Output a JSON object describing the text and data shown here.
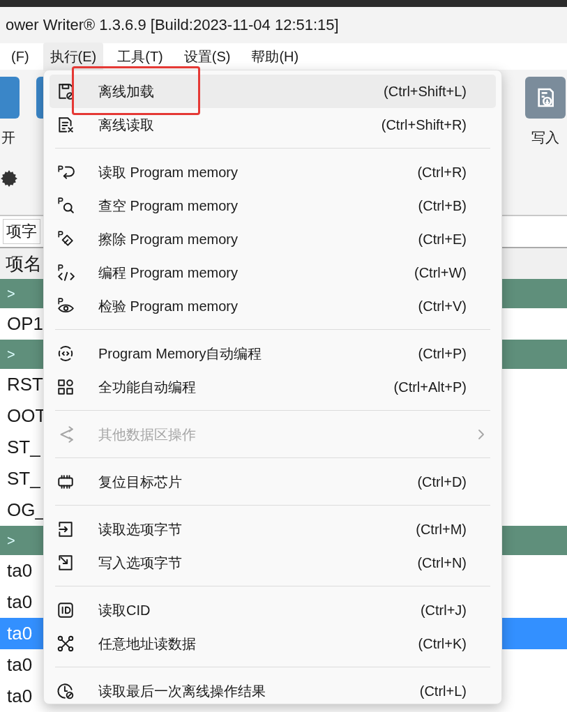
{
  "window": {
    "title": "ower Writer® 1.3.6.9 [Build:2023-11-04 12:51:15]"
  },
  "menu_bar": [
    {
      "label": "(F)",
      "selected": false
    },
    {
      "label": "执行(E)",
      "selected": true
    },
    {
      "label": "工具(T)",
      "selected": false
    },
    {
      "label": "设置(S)",
      "selected": false
    },
    {
      "label": "帮助(H)",
      "selected": false
    }
  ],
  "toolbar": {
    "left_label": "开",
    "right_button": "写入"
  },
  "background_list": {
    "filter": "项字",
    "header": "项名",
    "rows": [
      {
        "kind": "group",
        "text": ">",
        "selected": false
      },
      {
        "kind": "item",
        "text": "OP1",
        "selected": false
      },
      {
        "kind": "group",
        "text": ">",
        "selected": false
      },
      {
        "kind": "item",
        "text": "RST",
        "selected": false
      },
      {
        "kind": "item",
        "text": "OOT",
        "selected": false
      },
      {
        "kind": "item",
        "text": "ST_",
        "selected": false
      },
      {
        "kind": "item",
        "text": "ST_",
        "selected": false
      },
      {
        "kind": "item",
        "text": "OG_",
        "selected": false
      },
      {
        "kind": "group",
        "text": ">",
        "selected": false
      },
      {
        "kind": "item",
        "text": "ta0",
        "selected": false
      },
      {
        "kind": "item",
        "text": "ta0",
        "selected": false
      },
      {
        "kind": "item",
        "text": "ta0",
        "selected": true
      },
      {
        "kind": "item",
        "text": "ta0",
        "selected": false
      },
      {
        "kind": "item",
        "text": "ta0",
        "selected": false
      }
    ]
  },
  "menu": {
    "groups": [
      [
        {
          "label": "离线加载",
          "shortcut": "(Ctrl+Shift+L)",
          "highlighted": true,
          "disabled": false,
          "submenu": false
        },
        {
          "label": "离线读取",
          "shortcut": "(Ctrl+Shift+R)",
          "highlighted": false,
          "disabled": false,
          "submenu": false
        }
      ],
      [
        {
          "label": "读取 Program memory",
          "shortcut": "(Ctrl+R)",
          "highlighted": false,
          "disabled": false,
          "submenu": false
        },
        {
          "label": "查空 Program memory",
          "shortcut": "(Ctrl+B)",
          "highlighted": false,
          "disabled": false,
          "submenu": false
        },
        {
          "label": "擦除 Program memory",
          "shortcut": "(Ctrl+E)",
          "highlighted": false,
          "disabled": false,
          "submenu": false
        },
        {
          "label": "编程 Program memory",
          "shortcut": "(Ctrl+W)",
          "highlighted": false,
          "disabled": false,
          "submenu": false
        },
        {
          "label": "检验 Program memory",
          "shortcut": "(Ctrl+V)",
          "highlighted": false,
          "disabled": false,
          "submenu": false
        }
      ],
      [
        {
          "label": "Program Memory自动编程",
          "shortcut": "(Ctrl+P)",
          "highlighted": false,
          "disabled": false,
          "submenu": false
        },
        {
          "label": "全功能自动编程",
          "shortcut": "(Ctrl+Alt+P)",
          "highlighted": false,
          "disabled": false,
          "submenu": false
        }
      ],
      [
        {
          "label": "其他数据区操作",
          "highlighted": false,
          "disabled": true,
          "submenu": true
        }
      ],
      [
        {
          "label": "复位目标芯片",
          "shortcut": "(Ctrl+D)",
          "highlighted": false,
          "disabled": false,
          "submenu": false
        }
      ],
      [
        {
          "label": "读取选项字节",
          "shortcut": "(Ctrl+M)",
          "highlighted": false,
          "disabled": false,
          "submenu": false
        },
        {
          "label": "写入选项字节",
          "shortcut": "(Ctrl+N)",
          "highlighted": false,
          "disabled": false,
          "submenu": false
        }
      ],
      [
        {
          "label": "读取CID",
          "shortcut": "(Ctrl+J)",
          "highlighted": false,
          "disabled": false,
          "submenu": false
        },
        {
          "label": "任意地址读数据",
          "shortcut": "(Ctrl+K)",
          "highlighted": false,
          "disabled": false,
          "submenu": false
        }
      ],
      [
        {
          "label": "读取最后一次离线操作结果",
          "shortcut": "(Ctrl+L)",
          "highlighted": false,
          "disabled": false,
          "submenu": false
        }
      ]
    ]
  }
}
